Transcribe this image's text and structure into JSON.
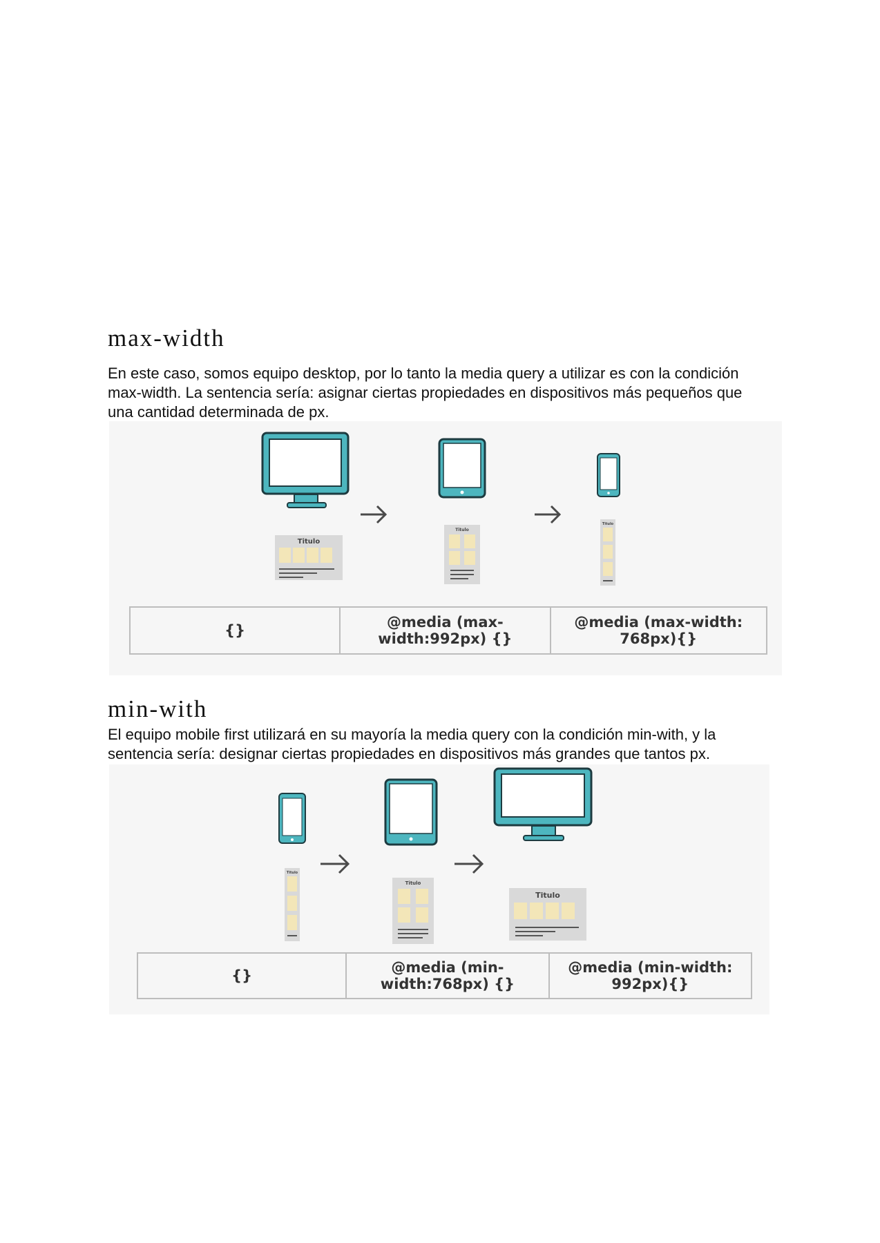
{
  "sections": {
    "max": {
      "heading": "max-width",
      "paragraph": "En este caso, somos equipo desktop, por lo tanto la media query a utilizar es con la condición max-width. La sentencia sería: asignar ciertas propiedades en dispositivos más pequeños que una cantidad determinada de px.",
      "mock_title": "Titulo",
      "table": [
        "{}",
        "@media (max-width:992px) {}",
        "@media (max-width: 768px){}"
      ]
    },
    "min": {
      "heading": "min-with",
      "paragraph": "El equipo mobile first utilizará en su mayoría la media query con la condición min-with, y la sentencia sería: designar ciertas propiedades en dispositivos más grandes que tantos px.",
      "mock_title": "Titulo",
      "table": [
        "{}",
        "@media (min-width:768px) {}",
        "@media (min-width: 992px){}"
      ]
    }
  },
  "colors": {
    "device_fill": "#4db6bf",
    "device_outline": "#1d3b40",
    "figure_bg": "#f6f6f6",
    "mock_bg": "#d9d9d9",
    "card_bg": "#f3e6b8",
    "arrow": "#4a4a4a"
  },
  "icons": [
    "desktop-monitor-icon",
    "tablet-icon",
    "smartphone-icon",
    "arrow-right-icon"
  ]
}
